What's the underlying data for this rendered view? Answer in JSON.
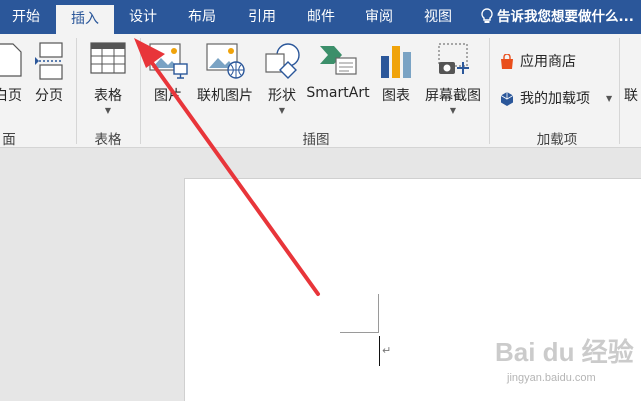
{
  "tabs": [
    {
      "label": "开始",
      "active": false
    },
    {
      "label": "插入",
      "active": true
    },
    {
      "label": "设计",
      "active": false
    },
    {
      "label": "布局",
      "active": false
    },
    {
      "label": "引用",
      "active": false
    },
    {
      "label": "邮件",
      "active": false
    },
    {
      "label": "审阅",
      "active": false
    },
    {
      "label": "视图",
      "active": false
    }
  ],
  "tell_me": "告诉我您想要做什么...",
  "ribbon": {
    "pages_group": {
      "partial_button": "白页",
      "page_break": "分页",
      "label": "面"
    },
    "tables_group": {
      "table": "表格",
      "label": "表格"
    },
    "illustrations_group": {
      "picture": "图片",
      "online_picture": "联机图片",
      "shapes": "形状",
      "smartart": "SmartArt",
      "chart": "图表",
      "screenshot": "屏幕截图",
      "label": "插图"
    },
    "addins_group": {
      "store": "应用商店",
      "my_addins": "我的加载项",
      "label": "加载项"
    },
    "next_partial": "联"
  },
  "document": {
    "paragraph_mark": "↵"
  },
  "watermark": {
    "logo": "Bai du 经验",
    "url": "jingyan.baidu.com"
  },
  "colors": {
    "accent": "#2b579a",
    "arrow": "#e8353a"
  }
}
